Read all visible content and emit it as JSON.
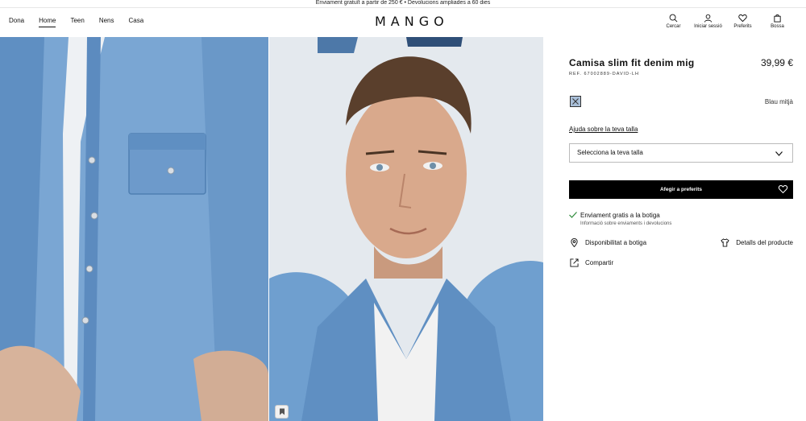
{
  "promo": "Enviament gratuït a partir de 250 € • Devolucions ampliades a 60 dies",
  "nav": {
    "items": [
      "Dona",
      "Home",
      "Teen",
      "Nens",
      "Casa"
    ],
    "active": "Home"
  },
  "logo": "MANGO",
  "actions": {
    "search": "Cercar",
    "login": "Iniciar sessió",
    "favorites": "Preferits",
    "bag": "Bossa"
  },
  "product": {
    "title": "Camisa slim fit denim mig",
    "price": "39,99 €",
    "ref": "REF. 67002889-DAVID-LH",
    "color_name": "Blau mitjà",
    "color_swatch": "#a9bfd8",
    "size_help": "Ajuda sobre la teva talla",
    "size_placeholder": "Selecciona la teva talla",
    "add_favorites": "Afegir a preferits"
  },
  "shipping": {
    "title": "Enviament gratis a la botiga",
    "subtitle": "Informació sobre enviaments i devolucions"
  },
  "info": {
    "stock": "Disponibilitat a botiga",
    "details": "Detalls del producte",
    "share": "Compartir"
  },
  "colors": {
    "denim": "#6f9fcf",
    "denim_dark": "#4f7fb1",
    "button_bg": "#000000",
    "check": "#2d8a3a"
  }
}
